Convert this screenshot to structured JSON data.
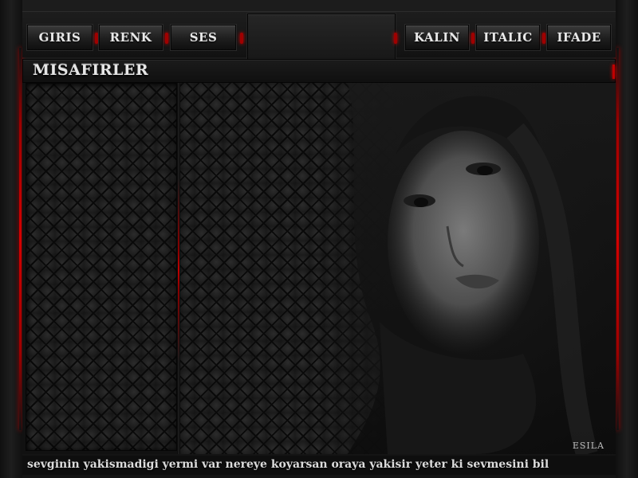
{
  "toolbar": {
    "left_buttons": [
      {
        "label": "GIRIS"
      },
      {
        "label": "RENK"
      },
      {
        "label": "SES"
      }
    ],
    "right_buttons": [
      {
        "label": "KALIN"
      },
      {
        "label": "ITALIC"
      },
      {
        "label": "IFADE"
      }
    ]
  },
  "titlebar": {
    "title": "MISAFIRLER"
  },
  "chat": {
    "watermark": "ESILA"
  },
  "marquee": {
    "text": "sevginin yakismadigi yermi var nereye koyarsan oraya yakisir yeter ki sevmesini bil"
  },
  "colors": {
    "accent_red": "#c00000",
    "frame_dark": "#141414",
    "text_light": "#e6e6e6"
  }
}
